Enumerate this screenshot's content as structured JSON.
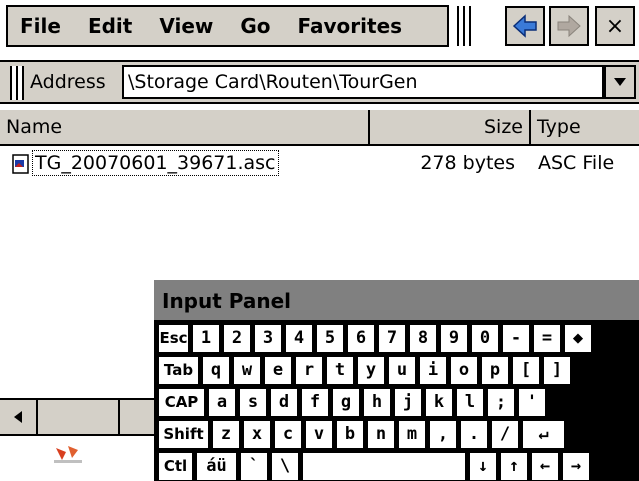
{
  "menu": {
    "items": [
      "File",
      "Edit",
      "View",
      "Go",
      "Favorites"
    ],
    "back_icon": "back-arrow-icon",
    "forward_icon": "forward-arrow-icon",
    "close_label": "×"
  },
  "address": {
    "label": "Address",
    "value": "\\Storage Card\\Routen\\TourGen",
    "dropdown_icon": "chevron-down-icon"
  },
  "list": {
    "columns": {
      "name": "Name",
      "size": "Size",
      "type": "Type"
    },
    "rows": [
      {
        "name": "TG_20070601_39671.asc",
        "size": "278 bytes",
        "type": "ASC File",
        "icon": "document-icon"
      }
    ]
  },
  "input_panel": {
    "title": "Input Panel",
    "rows": [
      [
        "Esc",
        "1",
        "2",
        "3",
        "4",
        "5",
        "6",
        "7",
        "8",
        "9",
        "0",
        "-",
        "=",
        "◆"
      ],
      [
        "Tab",
        "q",
        "w",
        "e",
        "r",
        "t",
        "y",
        "u",
        "i",
        "o",
        "p",
        "[",
        "]"
      ],
      [
        "CAP",
        "a",
        "s",
        "d",
        "f",
        "g",
        "h",
        "j",
        "k",
        "l",
        ";",
        "'"
      ],
      [
        "Shift",
        "z",
        "x",
        "c",
        "v",
        "b",
        "n",
        "m",
        ",",
        ".",
        "/",
        "↵"
      ],
      [
        "Ctl",
        "áü",
        "`",
        "\\",
        "",
        "↓",
        "↑",
        "←",
        "→"
      ]
    ]
  },
  "colors": {
    "chrome": "#d4d0c8",
    "panel_title": "#808080",
    "back_arrow": "#3a7ad8",
    "forward_arrow": "#b0a8a0"
  }
}
